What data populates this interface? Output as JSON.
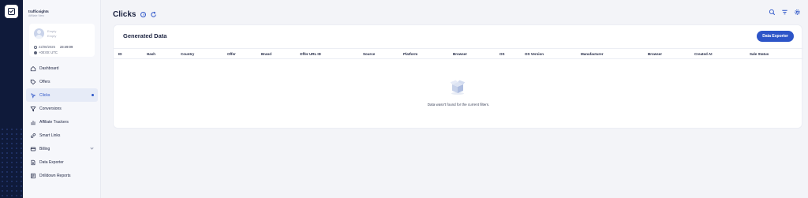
{
  "app": {
    "brand_name": "trafficsights",
    "brand_sub": "Affiliate View"
  },
  "user": {
    "name": "Empty",
    "email": "Empty",
    "date": "22/08/2025",
    "time": "23:49:09",
    "timezone": "+00:00: UTC"
  },
  "sidebar": {
    "items": [
      {
        "label": "Dashboard",
        "icon": "home-icon"
      },
      {
        "label": "Offers",
        "icon": "tag-icon"
      },
      {
        "label": "Clicks",
        "icon": "clicks-icon",
        "active": true
      },
      {
        "label": "Conversions",
        "icon": "funnel-icon"
      },
      {
        "label": "Affiliate Trackers",
        "icon": "tracker-icon"
      },
      {
        "label": "Smart Links",
        "icon": "link-icon"
      },
      {
        "label": "Billing",
        "icon": "billing-icon",
        "expandable": true
      },
      {
        "label": "Data Exporter",
        "icon": "exporter-icon"
      },
      {
        "label": "Drilldown Reports",
        "icon": "report-icon"
      }
    ]
  },
  "header": {
    "title": "Clicks",
    "help": "?"
  },
  "main": {
    "card_title": "Generated Data",
    "export_button": "Data Exporter",
    "columns": [
      "ID",
      "Hash",
      "Country",
      "Offer",
      "Brand",
      "Offer URL ID",
      "Source",
      "Platform",
      "Browser",
      "OS",
      "OS Version",
      "Manufacturer",
      "Browser",
      "Created At",
      "Sale Status"
    ],
    "empty_message": "Data wasn't found for the current filters."
  },
  "colors": {
    "accent": "#2d55c8",
    "rail": "#0f1a3a",
    "active_bg": "#e6ebf7"
  }
}
